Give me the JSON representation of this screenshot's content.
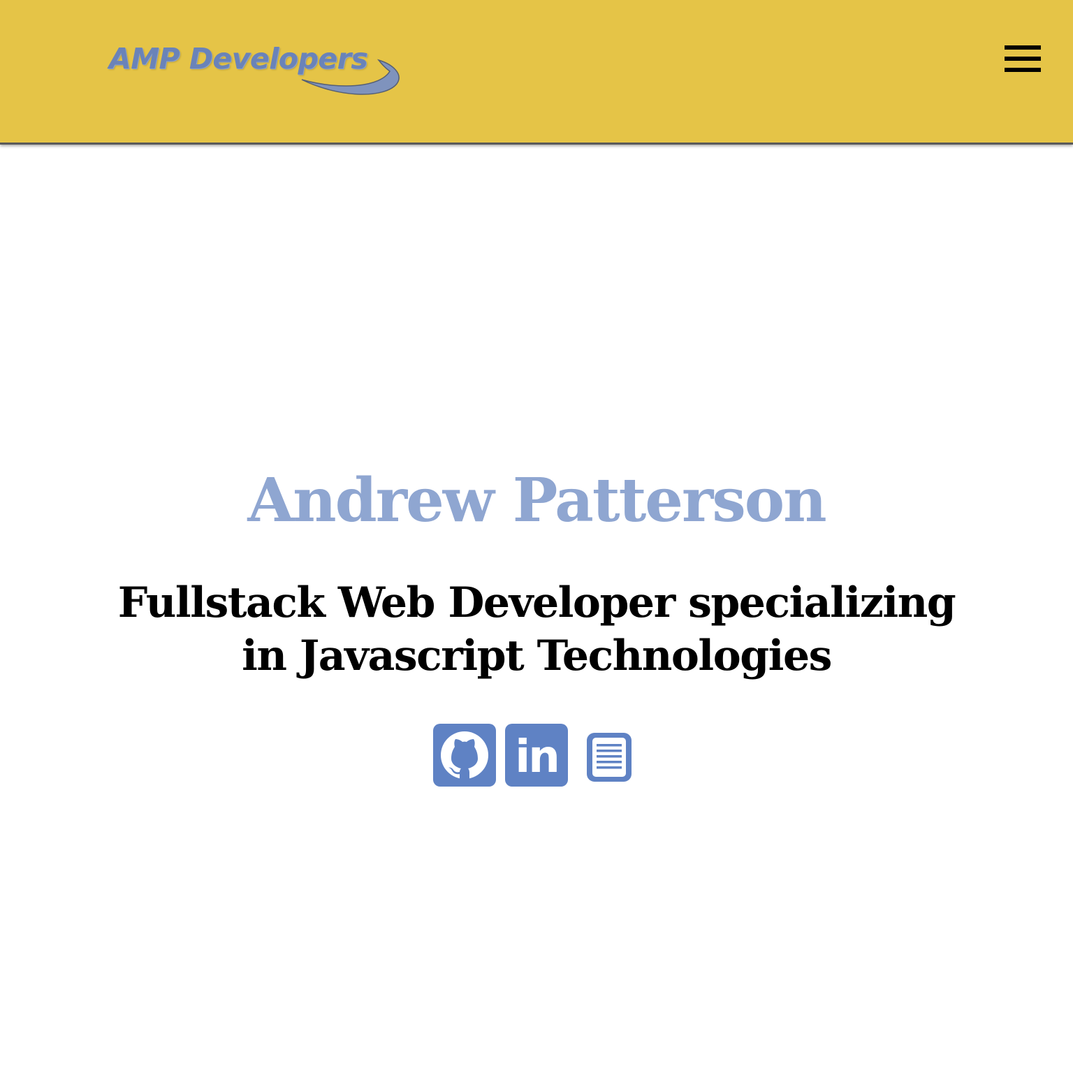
{
  "header": {
    "logo_text": "AMP Developers",
    "menu_icon": "hamburger-menu-icon",
    "background_color": "#e5c447"
  },
  "hero": {
    "name": "Andrew Patterson",
    "tagline": "Fullstack Web Developer specializing in Javascript Technologies",
    "name_color": "#8fa6d1"
  },
  "social": {
    "icons": [
      "github-icon",
      "linkedin-icon",
      "resume-document-icon"
    ],
    "icon_color": "#5f82c4",
    "linkedin_glyph": "in"
  }
}
